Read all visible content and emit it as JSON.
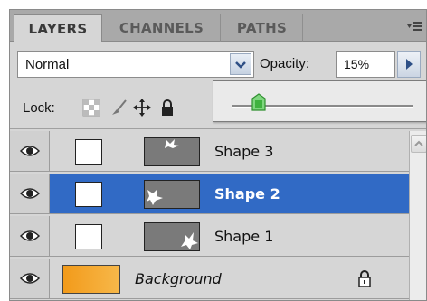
{
  "tabs": [
    {
      "label": "LAYERS",
      "active": true
    },
    {
      "label": "CHANNELS",
      "active": false
    },
    {
      "label": "PATHS",
      "active": false
    }
  ],
  "icons": {
    "panel_menu": "panel-menu-icon",
    "blend_arrow": "chevron-down-icon",
    "opacity_arrow": "chevron-right-icon",
    "lock_transparent": "checkerboard-icon",
    "lock_image": "brush-icon",
    "lock_position": "move-icon",
    "lock_all": "lock-icon",
    "visibility": "eye-icon",
    "scroll_up": "chevron-up-icon"
  },
  "blend_mode": {
    "value": "Normal"
  },
  "opacity": {
    "label": "Opacity:",
    "value": "15%",
    "slider_fraction": 0.15
  },
  "lock": {
    "label": "Lock:"
  },
  "layers": [
    {
      "name": "Shape 3",
      "selected": false
    },
    {
      "name": "Shape 2",
      "selected": true
    },
    {
      "name": "Shape 1",
      "selected": false
    },
    {
      "name": "Background",
      "selected": false,
      "locked": true
    }
  ],
  "colors": {
    "selection": "#316ac5",
    "background_gradient_start": "#f29a1a",
    "background_gradient_end": "#f7b84a",
    "slider_thumb": "#3fb23f"
  }
}
